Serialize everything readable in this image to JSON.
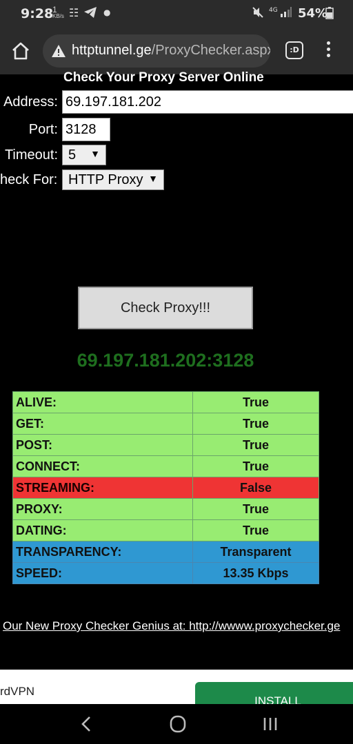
{
  "status_bar": {
    "time": "9:28",
    "net_speed_value": "1",
    "net_speed_unit": "KB/s",
    "battery_percent": "54%"
  },
  "browser": {
    "url_domain": "httptunnel.ge",
    "url_path": "/ProxyChecker.aspx",
    "tabs_label": ":D"
  },
  "page": {
    "title": "Check Your Proxy Server Online",
    "address_label": "Address:",
    "address_value": "69.197.181.202",
    "port_label": "Port:",
    "port_value": "3128",
    "timeout_label": "Timeout:",
    "timeout_value": "5",
    "check_for_label": "heck For:",
    "check_for_value": "HTTP Proxy",
    "check_button": "Check Proxy!!!",
    "result_address": "69.197.181.202:3128",
    "results": [
      {
        "label": "ALIVE:",
        "value": "True",
        "status": "green"
      },
      {
        "label": "GET:",
        "value": "True",
        "status": "green"
      },
      {
        "label": "POST:",
        "value": "True",
        "status": "green"
      },
      {
        "label": "CONNECT:",
        "value": "True",
        "status": "green"
      },
      {
        "label": "STREAMING:",
        "value": "False",
        "status": "red"
      },
      {
        "label": "PROXY:",
        "value": "True",
        "status": "green"
      },
      {
        "label": "DATING:",
        "value": "True",
        "status": "green"
      },
      {
        "label": "TRANSPARENCY:",
        "value": "Transparent",
        "status": "blue"
      },
      {
        "label": "SPEED:",
        "value": "13.35 Kbps",
        "status": "blue"
      }
    ],
    "footer_link": "Our New Proxy Checker Genius at: http://wwww.proxychecker.ge"
  },
  "ad": {
    "text": "rdVPN",
    "install_label": "INSTALL"
  },
  "colors": {
    "green_row": "#98ec72",
    "red_row": "#ef3434",
    "blue_row": "#2f98d2",
    "result_address": "#1e6e1e"
  }
}
